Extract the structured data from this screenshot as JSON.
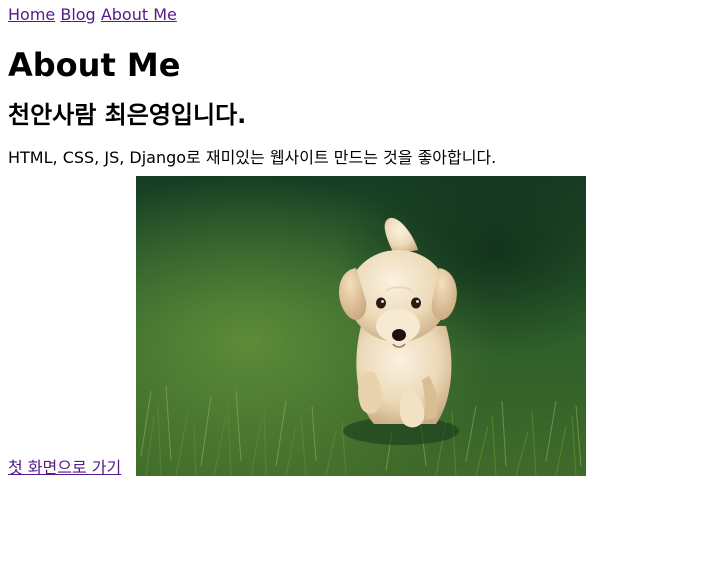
{
  "nav": {
    "items": [
      {
        "label": "Home"
      },
      {
        "label": "Blog"
      },
      {
        "label": "About Me"
      }
    ]
  },
  "heading": "About Me",
  "subheading": "천안사람 최은영입니다.",
  "intro": "HTML, CSS, JS, Django로 재미있는 웹사이트 만드는 것을 좋아합니다.",
  "back_link": "첫 화면으로 가기",
  "image": {
    "alt": "잔디 위를 걷는 강아지"
  },
  "colors": {
    "visited_link": "#551a8b",
    "text": "#000000"
  }
}
